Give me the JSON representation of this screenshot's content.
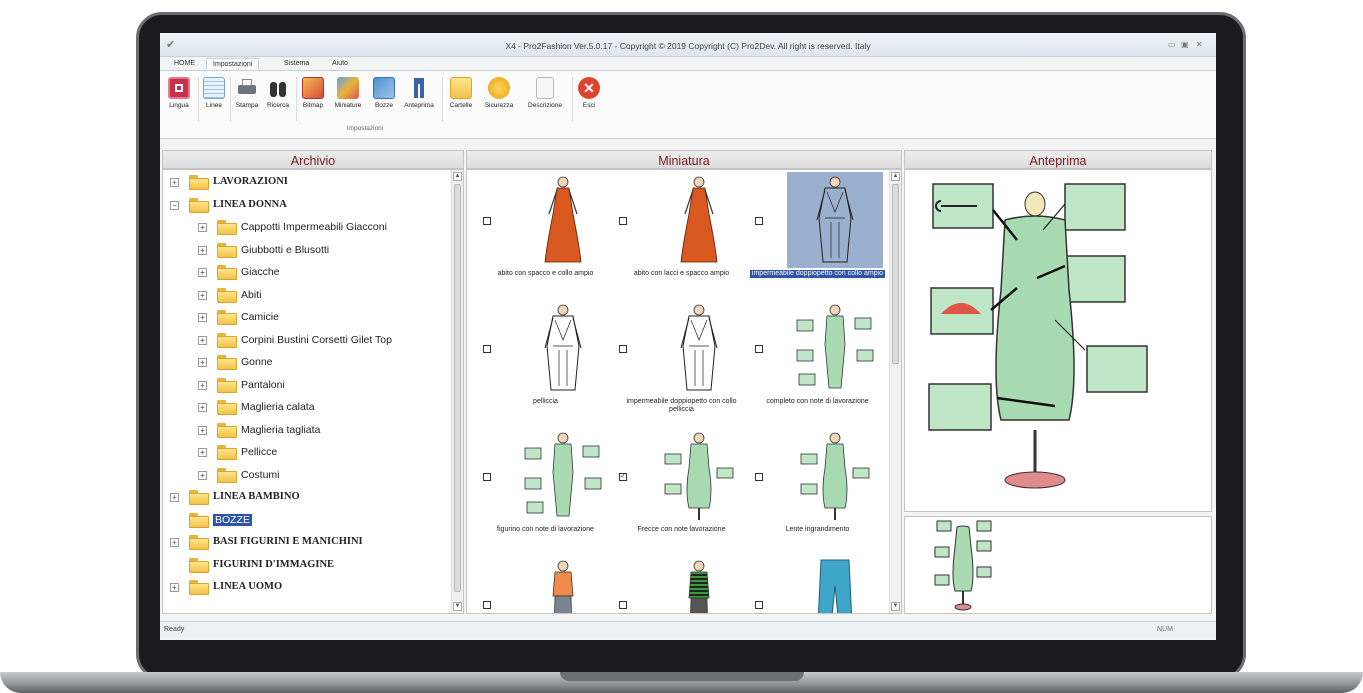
{
  "window": {
    "title": "X4 - Pro2Fashion Ver.5.0.17 - Copyright © 2019 Copyright (C) Pro2Dev. All right is reserved. Italy"
  },
  "tabs": [
    {
      "label": "HOME"
    },
    {
      "label": "Impostazioni",
      "active": true
    },
    {
      "label": "Sistema"
    },
    {
      "label": "Aiuto"
    }
  ],
  "ribbon": {
    "buttons": [
      {
        "label": "Lingua",
        "icon": "language-icon"
      },
      {
        "label": "Linee",
        "icon": "lines-icon"
      },
      {
        "label": "Stampa",
        "icon": "printer-icon"
      },
      {
        "label": "Ricerca",
        "icon": "binoculars-icon"
      },
      {
        "label": "Bitmap",
        "icon": "bitmap-icon"
      },
      {
        "label": "Miniature",
        "icon": "thumbnails-icon"
      },
      {
        "label": "Bozze",
        "icon": "drafts-icon"
      },
      {
        "label": "Anteprima",
        "icon": "preview-icon"
      },
      {
        "label": "Cartelle",
        "icon": "folders-icon"
      },
      {
        "label": "Sicurezza",
        "icon": "security-icon"
      },
      {
        "label": "Descrizione",
        "icon": "description-icon"
      },
      {
        "label": "Esci",
        "icon": "exit-icon"
      }
    ],
    "group_label": "Impostazioni"
  },
  "panels": {
    "archivio": "Archivio",
    "miniatura": "Miniatura",
    "anteprima": "Anteprima"
  },
  "tree": [
    {
      "label": "LAVORAZIONI",
      "level": 0,
      "expander": "+",
      "bold": true
    },
    {
      "label": "LINEA DONNA",
      "level": 0,
      "expander": "−",
      "bold": true
    },
    {
      "label": "Cappotti Impermeabili Giacconi",
      "level": 1,
      "expander": "+"
    },
    {
      "label": "Giubbotti e Blusotti",
      "level": 1,
      "expander": "+"
    },
    {
      "label": "Giacche",
      "level": 1,
      "expander": "+"
    },
    {
      "label": "Abiti",
      "level": 1,
      "expander": "+"
    },
    {
      "label": "Camicie",
      "level": 1,
      "expander": "+"
    },
    {
      "label": "Corpini Bustini Corsetti Gilet Top",
      "level": 1,
      "expander": "+"
    },
    {
      "label": "Gonne",
      "level": 1,
      "expander": "+"
    },
    {
      "label": "Pantaloni",
      "level": 1,
      "expander": "+"
    },
    {
      "label": "Maglieria calata",
      "level": 1,
      "expander": "+"
    },
    {
      "label": "Maglieria tagliata",
      "level": 1,
      "expander": "+"
    },
    {
      "label": "Pellicce",
      "level": 1,
      "expander": "+"
    },
    {
      "label": "Costumi",
      "level": 1,
      "expander": "+"
    },
    {
      "label": "LINEA BAMBINO",
      "level": 0,
      "expander": "+",
      "bold": true
    },
    {
      "label": "BOZZE",
      "level": 0,
      "expander": "",
      "selected": true
    },
    {
      "label": "BASI FIGURINI E MANICHINI",
      "level": 0,
      "expander": "+",
      "bold": true
    },
    {
      "label": "FIGURINI D'IMMAGINE",
      "level": 0,
      "expander": "",
      "bold": true
    },
    {
      "label": "LINEA UOMO",
      "level": 0,
      "expander": "+",
      "bold": true
    }
  ],
  "thumbnails": [
    {
      "caption": "abito con spacco e collo ampio",
      "checked": false,
      "style": "red-dress"
    },
    {
      "caption": "abito con lacci e spacco ampio",
      "checked": false,
      "style": "red-dress"
    },
    {
      "caption": "impermeabile doppiopetto con collo ampio",
      "checked": false,
      "style": "sketch",
      "selected": true
    },
    {
      "caption": "pelliccia",
      "checked": false,
      "style": "sketch"
    },
    {
      "caption": "impermeabile doppiopetto con collo pelliccia",
      "checked": false,
      "style": "sketch"
    },
    {
      "caption": "completo con note di lavorazione",
      "checked": false,
      "style": "notes"
    },
    {
      "caption": "figurino con note di lavorazione",
      "checked": false,
      "style": "notes"
    },
    {
      "caption": "Frecce con note lavorazione",
      "checked": true,
      "style": "mannequin"
    },
    {
      "caption": "Lente  ingrandimento",
      "checked": false,
      "style": "mannequin"
    },
    {
      "caption": "",
      "checked": false,
      "style": "orange-top"
    },
    {
      "caption": "",
      "checked": false,
      "style": "striped-top"
    },
    {
      "caption": "",
      "checked": false,
      "style": "jeans"
    }
  ],
  "statusbar": {
    "left": "Ready",
    "right": "NUM"
  },
  "colors": {
    "panel_title": "#7a1d1d",
    "selection": "#2f55a6",
    "mannequin_green": "#a9dbb3"
  }
}
